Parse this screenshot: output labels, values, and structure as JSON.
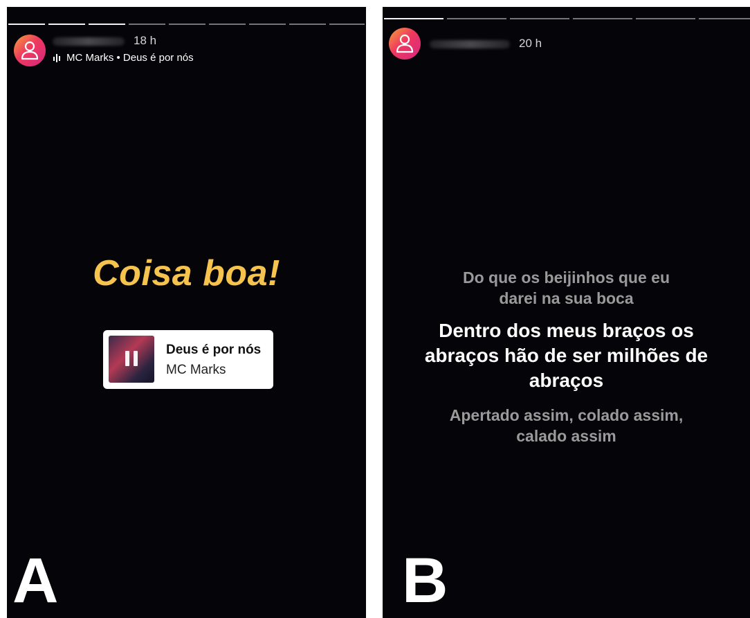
{
  "panel_a": {
    "time": "18 h",
    "music_line": "MC Marks • Deus é por nós",
    "caption": "Coisa boa!",
    "sticker": {
      "title": "Deus é por nós",
      "artist": "MC Marks"
    },
    "letter": "A"
  },
  "panel_b": {
    "time": "20 h",
    "lyrics_before": [
      "Do que os beijinhos que eu",
      "darei na sua boca"
    ],
    "lyrics_current": [
      "Dentro dos meus braços os",
      "abraços hão de ser milhões de",
      "abraços"
    ],
    "lyrics_after": [
      "Apertado assim, colado assim,",
      "calado assim"
    ],
    "letter": "B"
  },
  "colors": {
    "caption": "#f6c44e",
    "avatar_gradient": [
      "#f7a13b",
      "#ee3a5e",
      "#d72682"
    ],
    "background": "#050408"
  }
}
